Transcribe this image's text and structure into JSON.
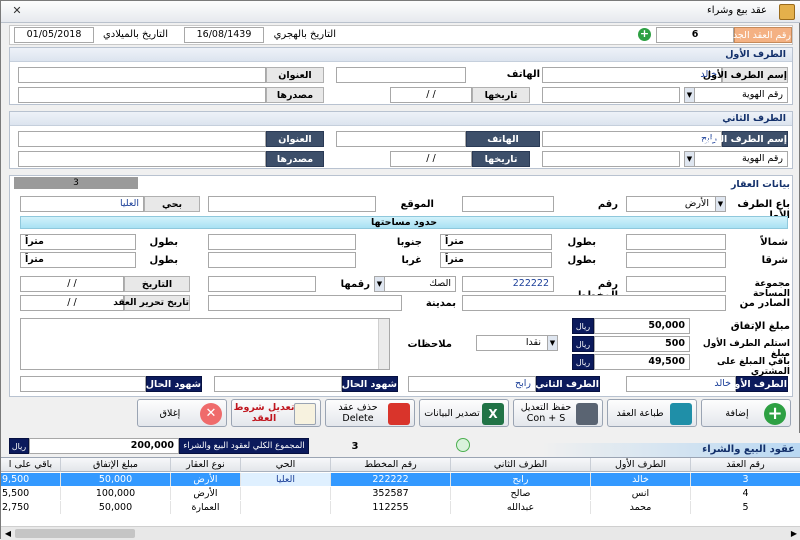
{
  "window": {
    "title": "عقد بيع وشراء"
  },
  "header": {
    "new_contract_label": "رقم العقد الجديد",
    "new_contract_value": "6",
    "hijri_label": "التاريخ بالهجري",
    "hijri_value": "16/08/1439",
    "gregorian_label": "التاريخ بالميلادي",
    "gregorian_value": "01/05/2018"
  },
  "party1": {
    "section_title": "الطرف الأول",
    "name_label": "إسم الطرف الأول",
    "name_value": "خالد",
    "phone_label": "الهاتف",
    "phone_value": "",
    "address_label": "العنوان",
    "address_value": "",
    "id_type_value": "رقم الهوية",
    "id_number_value": "",
    "date_label": "تاريخها",
    "date_value": "/ /",
    "source_label": "مصدرها",
    "source_value": ""
  },
  "party2": {
    "section_title": "الطرف الثاني",
    "name_label": "إسم الطرف الثاني",
    "name_value": "رابح",
    "phone_label": "الهاتف",
    "phone_value": "",
    "address_label": "العنوان",
    "address_value": "",
    "id_type_value": "رقم الهوية",
    "id_number_value": "",
    "date_label": "تاريخها",
    "date_value": "/ /",
    "source_label": "مصدرها",
    "source_value": ""
  },
  "property": {
    "section_title": "بيانات العقار",
    "counter_value": "3",
    "sold_label": "باع الطرف الأول",
    "sold_value": "الأرض",
    "number_label": "رقم",
    "number_value": "",
    "location_label": "الموقع",
    "location_value": "",
    "district_label": "بحي",
    "district_value": "العليا",
    "bounds_title": "حدود مساحتها",
    "north_label": "شمالاً",
    "north_value": "",
    "south_label": "جنوبا",
    "south_value": "",
    "east_label": "شرقا",
    "east_value": "",
    "west_label": "غربا",
    "west_value": "",
    "length_label": "بطول",
    "meters_label": "متراً",
    "total_area_label": "مجموعة المساحة",
    "total_area_value": "",
    "plan_label": "رقم المخطط",
    "plan_value": "222222",
    "deed_value": "الصك",
    "deed_number_label": "رقمها",
    "deed_number_value": "",
    "deed_date_label": "التاريخ",
    "deed_date_value": "/ /",
    "issued_from_label": "الصادر من",
    "issued_from_value": "",
    "city_label": "بمدينة",
    "city_value": "",
    "contract_date_label": "تاريخ تحرير العقد",
    "contract_date_value": "/ /",
    "notes_label": "ملاحظات",
    "notes_value": ""
  },
  "amounts": {
    "agreed_label": "مبلغ الإتفاق",
    "agreed_value": "50,000",
    "received_label": "استلم الطرف الأول مبلغ",
    "received_value": "500",
    "remaining_label": "باقي المبلغ على المشتري",
    "remaining_value": "49,500",
    "currency": "ريال",
    "payment_method": "نقدا"
  },
  "witnesses": {
    "party1_label": "الطرف الأول",
    "party1_value": "خالد",
    "party2_label": "الطرف الثاني",
    "party2_value": "رابح",
    "witness1_label": "شهود الحال 1",
    "witness1_value": "",
    "witness2_label": "شهود الحال 2",
    "witness2_value": ""
  },
  "toolbar": {
    "add_label": "إضافة",
    "print_label": "طباعة العقد",
    "save_label": "حفظ التعديل",
    "save_shortcut": "Con + S",
    "export_label": "تصدير البيانات",
    "delete_label": "حذف عقد",
    "delete_en": "Delete",
    "terms_label1": "تعديل شروط",
    "terms_label2": "العقد",
    "close_label": "إغلاق"
  },
  "summary": {
    "section_title": "عقود البيع والشراء",
    "count_value": "3",
    "total_label": "المجموع الكلي لعقود البيع والشراء",
    "total_value": "200,000",
    "currency": "ريال"
  },
  "table": {
    "columns": [
      "رقم العقد",
      "الطرف الأول",
      "الطرف الثاني",
      "رقم المخطط",
      "الحي",
      "نوع العقار",
      "مبلغ الإتفاق",
      "باقي على ا"
    ],
    "rows": [
      [
        "3",
        "خالد",
        "رابح",
        "222222",
        "العليا",
        "الأرض",
        "50,000",
        "9,500"
      ],
      [
        "4",
        "انس",
        "صالح",
        "352587",
        "",
        "الأرض",
        "100,000",
        "5,500"
      ],
      [
        "5",
        "محمد",
        "عبدالله",
        "112255",
        "",
        "العمارة",
        "50,000",
        "2,750"
      ]
    ]
  },
  "colors": {
    "accent": "#0b1a5c",
    "selection": "#3399ff",
    "section_title": "#13306b"
  }
}
